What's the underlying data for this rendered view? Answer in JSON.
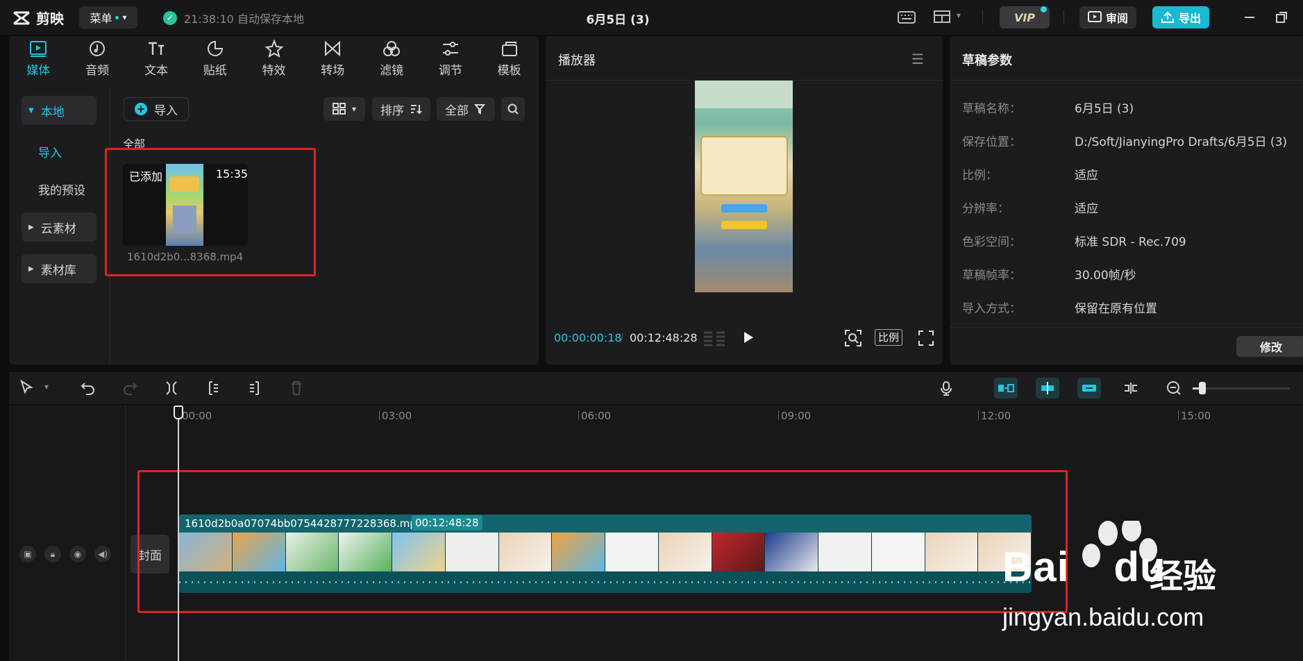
{
  "app": {
    "name": "剪映",
    "menu_label": "菜单",
    "autosave": "21:38:10 自动保存本地",
    "project_title": "6月5日 (3)"
  },
  "topbar": {
    "vip": "VIP",
    "review": "审阅",
    "export": "导出"
  },
  "tabs": [
    {
      "label": "媒体",
      "icon": "media-icon"
    },
    {
      "label": "音频",
      "icon": "audio-icon"
    },
    {
      "label": "文本",
      "icon": "text-icon"
    },
    {
      "label": "贴纸",
      "icon": "sticker-icon"
    },
    {
      "label": "特效",
      "icon": "effects-icon"
    },
    {
      "label": "转场",
      "icon": "transition-icon"
    },
    {
      "label": "滤镜",
      "icon": "filter-icon"
    },
    {
      "label": "调节",
      "icon": "adjust-icon"
    },
    {
      "label": "模板",
      "icon": "template-icon"
    }
  ],
  "nav": {
    "local": "本地",
    "import": "导入",
    "presets": "我的预设",
    "cloud": "云素材",
    "library": "素材库"
  },
  "media": {
    "import_label": "导入",
    "sort_label": "排序",
    "filter_label": "全部",
    "section_label": "全部",
    "card": {
      "status": "已添加",
      "duration": "15:35",
      "filename": "1610d2b0...8368.mp4"
    }
  },
  "player": {
    "title": "播放器",
    "current_time": "00:00:00:18",
    "total_time": "00:12:48:28",
    "ratio_label": "比例"
  },
  "params": {
    "title": "草稿参数",
    "rows": [
      {
        "label": "草稿名称：",
        "value": "6月5日 (3)"
      },
      {
        "label": "保存位置：",
        "value": "D:/Soft/JianyingPro Drafts/6月5日 (3)"
      },
      {
        "label": "比例：",
        "value": "适应"
      },
      {
        "label": "分辨率：",
        "value": "适应"
      },
      {
        "label": "色彩空间：",
        "value": "标准 SDR - Rec.709"
      },
      {
        "label": "草稿帧率：",
        "value": "30.00帧/秒"
      },
      {
        "label": "导入方式：",
        "value": "保留在原有位置"
      }
    ],
    "modify_label": "修改"
  },
  "timeline": {
    "ruler": [
      "00:00",
      "03:00",
      "06:00",
      "09:00",
      "12:00",
      "15:00"
    ],
    "cover_label": "封面",
    "clip": {
      "name": "1610d2b0a07074bb0754428777228368.mp4",
      "duration": "00:12:48:28"
    },
    "zoom_level": 0.1
  },
  "watermark": {
    "brand": "Bai",
    "brand2": "du",
    "cn": "经验",
    "url": "jingyan.baidu.com"
  },
  "colors": {
    "accent": "#25c6de",
    "highlight": "#e0231c",
    "clip": "#0f5d66"
  }
}
